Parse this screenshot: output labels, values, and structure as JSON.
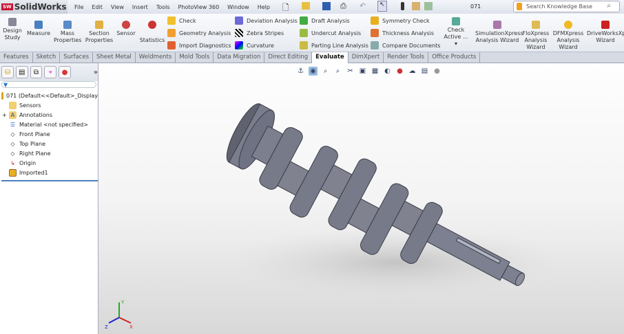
{
  "app": {
    "name": "SolidWorks",
    "logo_text": "SW"
  },
  "menu": [
    "File",
    "Edit",
    "View",
    "Insert",
    "Tools",
    "PhotoView 360",
    "Window",
    "Help"
  ],
  "document_title": "071",
  "search": {
    "placeholder": "Search Knowledge Base"
  },
  "ribbon": {
    "large": [
      {
        "label": "Design Study",
        "icon": "design-study-icon"
      },
      {
        "label": "Measure",
        "icon": "measure-icon"
      },
      {
        "label": "Mass Properties",
        "icon": "mass-properties-icon"
      },
      {
        "label": "Section Properties",
        "icon": "section-properties-icon"
      },
      {
        "label": "Sensor",
        "icon": "sensor-icon"
      },
      {
        "label": "Statistics",
        "icon": "statistics-icon"
      }
    ],
    "col1": [
      "Check",
      "Geometry Analysis",
      "Import Diagnostics"
    ],
    "col2": [
      "Deviation Analysis",
      "Zebra Stripes",
      "Curvature"
    ],
    "col3": [
      "Draft Analysis",
      "Undercut Analysis",
      "Parting Line Analysis"
    ],
    "col4": [
      "Symmetry Check",
      "Thickness Analysis",
      "Compare Documents"
    ],
    "check_active": "Check Active ...",
    "wizards": [
      "SimulationXpress Analysis Wizard",
      "FloXpress Analysis Wizard",
      "DFMXpress Analysis Wizard",
      "DriveWorksXpress Wizard"
    ]
  },
  "tabs": [
    "Features",
    "Sketch",
    "Surfaces",
    "Sheet Metal",
    "Weldments",
    "Mold Tools",
    "Data Migration",
    "Direct Editing",
    "Evaluate",
    "DimXpert",
    "Render Tools",
    "Office Products"
  ],
  "active_tab": "Evaluate",
  "tree": {
    "root": "071  (Default<<Default>_Display",
    "items": [
      "Sensors",
      "Annotations",
      "Material <not specified>",
      "Front Plane",
      "Top Plane",
      "Right Plane",
      "Origin",
      "Imported1"
    ]
  },
  "triad": {
    "x": "X",
    "y": "Y",
    "z": "Z"
  },
  "colors": {
    "part": "#6f7282",
    "accent": "#4a7fc0"
  }
}
